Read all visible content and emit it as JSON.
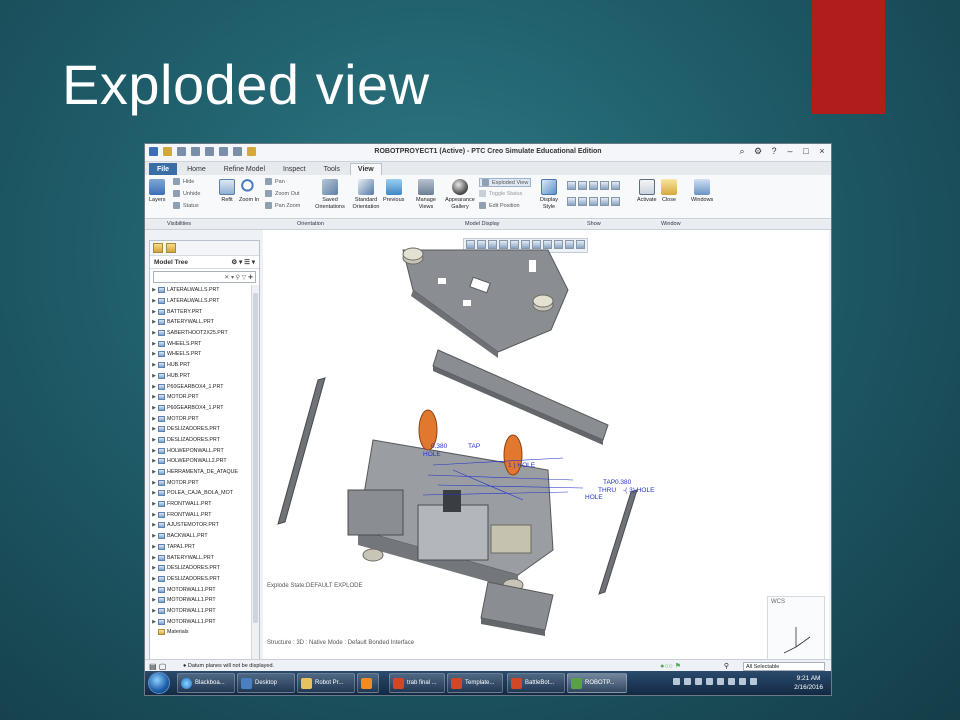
{
  "slide": {
    "title": "Exploded view",
    "accent_color": "#b11c1c"
  },
  "app": {
    "window_title": "ROBOTPROYECT1 (Active) - PTC Creo Simulate Educational Edition",
    "tabs": [
      "File",
      "Home",
      "Refine Model",
      "Inspect",
      "Tools",
      "View"
    ],
    "active_tab": "View",
    "ribbon": {
      "visibilities": {
        "layers": "Layers",
        "hide": "Hide",
        "unhide": "Unhide",
        "status": "Status"
      },
      "orientation": {
        "refit": "Refit",
        "zoom_in": "Zoom In",
        "pan": "Pan",
        "zoom_out": "Zoom Out",
        "pan_zoom": "Pan Zoom",
        "saved": "Saved Orientations",
        "standard": "Standard Orientation",
        "previous": "Previous"
      },
      "model_display": {
        "manage_views": "Manage Views",
        "appearance_gallery": "Appearance Gallery",
        "exploded_view": "Exploded View",
        "toggle_status": "Toggle Status",
        "edit_position": "Edit Position",
        "display_style": "Display Style"
      },
      "window": {
        "activate": "Activate",
        "close": "Close",
        "windows": "Windows"
      },
      "groups": [
        "Visibilities",
        "Orientation",
        "Model Display",
        "Show",
        "Window"
      ]
    },
    "model_tree": {
      "title": "Model Tree",
      "items": [
        "LATERALWALLS.PRT",
        "LATERALWALLS.PRT",
        "BATTERY.PRT",
        "BATERYWALL.PRT",
        "SABERTHOOT2X25.PRT",
        "WHEELS.PRT",
        "WHEELS.PRT",
        "HUB.PRT",
        "HUB.PRT",
        "P60GEARBOX4_1.PRT",
        "MOTOR.PRT",
        "P60GEARBOX4_1.PRT",
        "MOTOR.PRT",
        "DESLIZADORES.PRT",
        "DESLIZADORES.PRT",
        "HOLWEPONWALL.PRT",
        "HOLWEPONWALL2.PRT",
        "HERRAMENTA_DE_ATAQUE",
        "MOTOR.PRT",
        "POLEA_CAJA_BOLA_MOT",
        "FRONTWALL.PRT",
        "FRONTWALL.PRT",
        "AJUSTEMOTOR.PRT",
        "BACKWALL.PRT",
        "TAPA1.PRT",
        "BATERYWALL.PRT",
        "DESLIZADORES.PRT",
        "DESLIZADORES.PRT",
        "MOTORWALL1.PRT",
        "MOTORWALL1.PRT",
        "MOTORWALL1.PRT",
        "MOTORWALL1.PRT",
        "Materials"
      ]
    },
    "viewport": {
      "explode_state": "Explode State:DEFAULT EXPLODE",
      "structure_info": "Structure : 3D : Native Mode : Default Bonded Interface",
      "wcs_label": "WCS",
      "annotation_color": "#2233cc",
      "hole_annotations": [
        "HOLE",
        "1 ) HOLE",
        "TAP",
        "0.380",
        "THRU",
        "-( 3) HOLE",
        "HOLE",
        "0.380",
        "TAP"
      ]
    },
    "status": {
      "message": "Datum planes will not be displayed.",
      "selection_filter": "All Selectable"
    }
  },
  "taskbar": {
    "items": [
      "Blackboa...",
      "Desktop",
      "Robot Pr...",
      "",
      "trab final ...",
      "Template...",
      "BattleBot...",
      "ROBOTP..."
    ],
    "time": "9:21 AM",
    "date": "2/16/2016"
  }
}
